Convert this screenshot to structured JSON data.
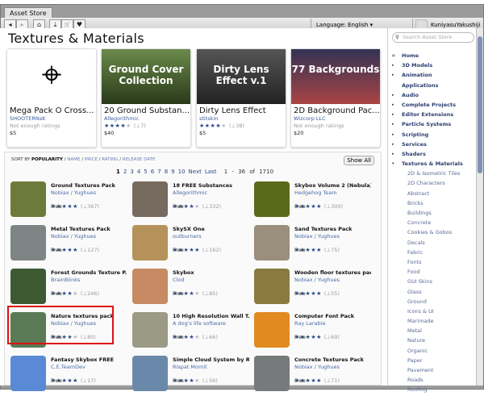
{
  "window": {
    "tab": "Asset Store",
    "language": "Language: English ▾",
    "user": "KuniyasuYakushiji ▾"
  },
  "toolbar": {
    "back": "◂",
    "forward": "▸",
    "home": "⌂",
    "downloads": "⤓",
    "cart": "🛒",
    "wishlist": "♥"
  },
  "page_title": "Textures & Materials",
  "featured": [
    {
      "title": "Mega Pack O Cross...",
      "publisher": "SHOOTERNsK",
      "rating_text": "Not enough ratings",
      "price": "$5",
      "art": "⌖"
    },
    {
      "title": "20 Ground Substan...",
      "publisher": "Allegorithmic",
      "stars": 4,
      "count": "(⊥7)",
      "price": "$40",
      "art": "Ground Cover Collection"
    },
    {
      "title": "Dirty Lens Effect",
      "publisher": "stitskin",
      "stars": 4,
      "count": "(⊥38)",
      "price": "$5",
      "art": "Dirty Lens Effect v.1"
    },
    {
      "title": "2D Background Pac...",
      "publisher": "Wizcorp LLC",
      "rating_text": "Not enough ratings",
      "price": "$20",
      "art": "77 Backgrounds"
    }
  ],
  "sort": {
    "label": "SORT BY",
    "active": "POPULARITY",
    "options": [
      "NAME",
      "PRICE",
      "RATING",
      "RELEASE DATE"
    ],
    "show_all": "Show All"
  },
  "pagination": {
    "pages": [
      "1",
      "2",
      "3",
      "4",
      "5",
      "6",
      "7",
      "8",
      "9",
      "10"
    ],
    "next": "Next",
    "last": "Last",
    "range": "1 - 36 of 1710"
  },
  "items": [
    {
      "name": "Ground Textures Pack",
      "publisher": "Nobiax / Yughues",
      "stars": 5,
      "count": "(⊥367)",
      "price": "Free",
      "color": "#6d7a3a"
    },
    {
      "name": "18 FREE Substances",
      "publisher": "Allegorithmic",
      "stars": 4,
      "count": "(⊥332)",
      "price": "Free",
      "color": "#776a5e"
    },
    {
      "name": "Skybox Volume 2 (Nebula)",
      "publisher": "Hedgehog Team",
      "stars": 5,
      "count": "(⊥300)",
      "price": "Free",
      "color": "#5a6a1a"
    },
    {
      "name": "Metal Textures Pack",
      "publisher": "Nobiax / Yughues",
      "stars": 5,
      "count": "(⊥127)",
      "price": "Free",
      "color": "#7d8585"
    },
    {
      "name": "SkySX One",
      "publisher": "outburners",
      "stars": 5,
      "count": "(⊥162)",
      "price": "Free",
      "color": "#b5925a"
    },
    {
      "name": "Sand Textures Pack",
      "publisher": "Nobiax / Yughues",
      "stars": 5,
      "count": "(⊥75)",
      "price": "Free",
      "color": "#9a8e7c"
    },
    {
      "name": "Forest Grounds Texture P...",
      "publisher": "BrainBlinks",
      "stars": 4,
      "count": "(⊥246)",
      "price": "Free",
      "color": "#3d5a33"
    },
    {
      "name": "Skybox",
      "publisher": "Clod",
      "stars": 4,
      "count": "(⊥85)",
      "price": "Free",
      "color": "#c78a62"
    },
    {
      "name": "Wooden floor textures pack",
      "publisher": "Nobiax / Yughues",
      "stars": 5,
      "count": "(⊥55)",
      "price": "Free",
      "color": "#8a7a40"
    },
    {
      "name": "Nature textures pack",
      "publisher": "Nobiax / Yughues",
      "stars": 4,
      "count": "(⊥80)",
      "price": "Free",
      "color": "#5a7a55"
    },
    {
      "name": "10 High Resolution Wall T...",
      "publisher": "A dog's life software",
      "stars": 4,
      "count": "(⊥66)",
      "price": "Free",
      "color": "#9a9a85"
    },
    {
      "name": "Computer Font Pack",
      "publisher": "Ray Larabie",
      "stars": 5,
      "count": "(⊥69)",
      "price": "Free",
      "color": "#e08a20"
    },
    {
      "name": "Fantasy Skybox FREE",
      "publisher": "C.E.TeamDev",
      "stars": 5,
      "count": "(⊥17)",
      "price": "Free",
      "color": "#5a8ad5"
    },
    {
      "name": "Simple Cloud System by RM",
      "publisher": "Rispat Momit",
      "stars": 4,
      "count": "(⊥56)",
      "price": "Free",
      "color": "#6a88aa"
    },
    {
      "name": "Concrete Textures Pack",
      "publisher": "Nobiax / Yughues",
      "stars": 5,
      "count": "(⊥71)",
      "price": "Free",
      "color": "#777a7a"
    }
  ],
  "sidebar": {
    "search_placeholder": "Search Asset Store",
    "categories": [
      {
        "label": "Home",
        "icon": "home"
      },
      {
        "label": "3D Models",
        "icon": "▸"
      },
      {
        "label": "Animation",
        "icon": "▸"
      },
      {
        "label": "Applications",
        "icon": ""
      },
      {
        "label": "Audio",
        "icon": "▸"
      },
      {
        "label": "Complete Projects",
        "icon": "▸"
      },
      {
        "label": "Editor Extensions",
        "icon": "▸"
      },
      {
        "label": "Particle Systems",
        "icon": "▸"
      },
      {
        "label": "Scripting",
        "icon": "▸"
      },
      {
        "label": "Services",
        "icon": "▸"
      },
      {
        "label": "Shaders",
        "icon": "▸"
      },
      {
        "label": "Textures & Materials",
        "icon": "▾"
      }
    ],
    "subcategories": [
      "2D & Isometric Tiles",
      "2D Characters",
      "Abstract",
      "Bricks",
      "Buildings",
      "Concrete",
      "Cookies & Gobos",
      "Decals",
      "Fabric",
      "Fonts",
      "Food",
      "GUI Skins",
      "Glass",
      "Ground",
      "Icons & UI",
      "Marimade",
      "Metal",
      "Nature",
      "Organic",
      "Paper",
      "Pavement",
      "Roads",
      "Roofing"
    ]
  }
}
